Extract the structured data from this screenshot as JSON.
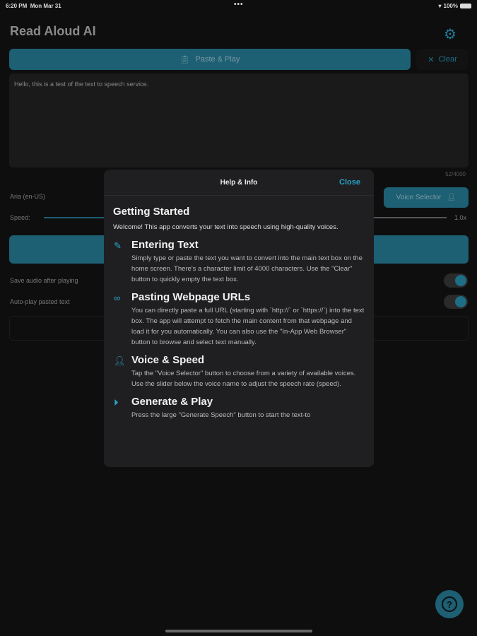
{
  "status": {
    "time": "6:20 PM",
    "date": "Mon Mar 31",
    "dots": "•••",
    "battery": "100%"
  },
  "app": {
    "title": "Read Aloud AI"
  },
  "toolbar": {
    "paste_play": "Paste & Play",
    "clear": "Clear"
  },
  "text_input": {
    "value": "Hello, this is a test of the text to speech service.",
    "count": "52/4000"
  },
  "voice": {
    "name": "Aria (en-US)",
    "selector_label": "Voice Selector",
    "speed_label": "Speed:",
    "speed_value": "1.0x",
    "speed_fraction": 0.15
  },
  "options": [
    {
      "label": "Save audio after playing",
      "on": true
    },
    {
      "label": "Auto-play pasted text",
      "on": true
    }
  ],
  "modal": {
    "title": "Help & Info",
    "close": "Close",
    "heading": "Getting Started",
    "intro": "Welcome! This app converts your text into speech using high-quality voices.",
    "sections": [
      {
        "icon": "pencil-icon",
        "title": "Entering Text",
        "body": "Simply type or paste the text you want to convert into the main text box on the home screen. There's a character limit of 4000 characters. Use the \"Clear\" button to quickly empty the text box."
      },
      {
        "icon": "link-icon",
        "title": "Pasting Webpage URLs",
        "body": "You can directly paste a full URL (starting with `http://` or `https://`) into the text box. The app will attempt to fetch the main content from that webpage and load it for you automatically. You can also use the \"In-App Web Browser\" button to browse and select text manually."
      },
      {
        "icon": "voice-icon",
        "title": "Voice & Speed",
        "body": "Tap the \"Voice Selector\" button to choose from a variety of available voices. Use the slider below the voice name to adjust the speech rate (speed)."
      },
      {
        "icon": "play-circle-icon",
        "title": "Generate & Play",
        "body": "Press the large \"Generate Speech\" button to start the text-to"
      }
    ]
  },
  "help_button": "?"
}
